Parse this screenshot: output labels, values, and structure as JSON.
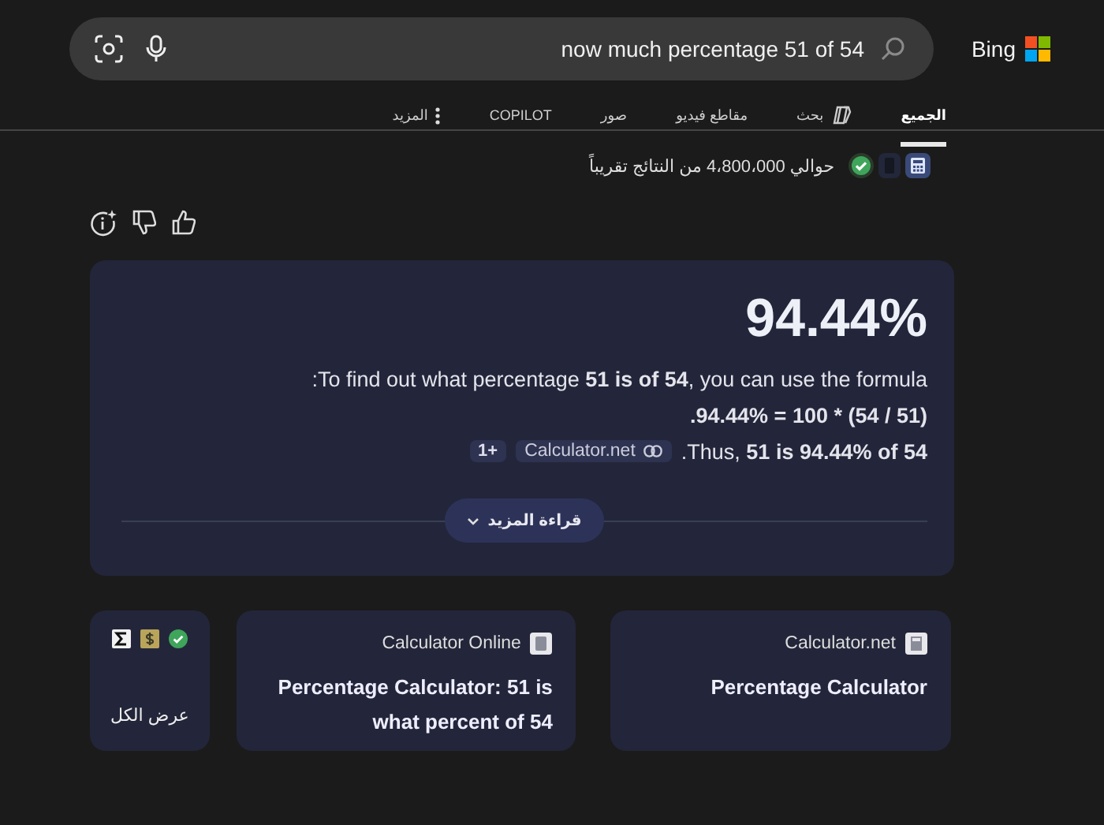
{
  "brand": {
    "name": "Bing"
  },
  "search": {
    "value": "now much percentage 51 of 54"
  },
  "tabs": [
    {
      "label": "الجميع",
      "selected": true,
      "kind": "plain"
    },
    {
      "label": "بحث",
      "selected": false,
      "kind": "copilot"
    },
    {
      "label": "مقاطع فيديو",
      "selected": false,
      "kind": "plain"
    },
    {
      "label": "صور",
      "selected": false,
      "kind": "plain"
    },
    {
      "label": "COPILOT",
      "selected": false,
      "kind": "plain"
    },
    {
      "label": "المزيد",
      "selected": false,
      "kind": "more"
    }
  ],
  "results_count": "حوالي 4،800،000 من النتائج تقريباً",
  "answer": {
    "value": "94.44%",
    "lines": [
      ":To find out what percentage **51 is of 54**, you can use the formula",
      "**.94.44% = 100 * (54 / 51)**",
      ".Thus, **51 is 94.44% of 54**"
    ],
    "citation": {
      "source": "Calculator.net",
      "count": "1+"
    },
    "read_more": "قراءة المزيد"
  },
  "sources": [
    {
      "site": "Calculator.net",
      "title": "Percentage Calculator"
    },
    {
      "site": "Calculator Online",
      "title": "Percentage Calculator: 51 is what percent of 54"
    }
  ],
  "see_all": {
    "label": "عرض الكل"
  }
}
